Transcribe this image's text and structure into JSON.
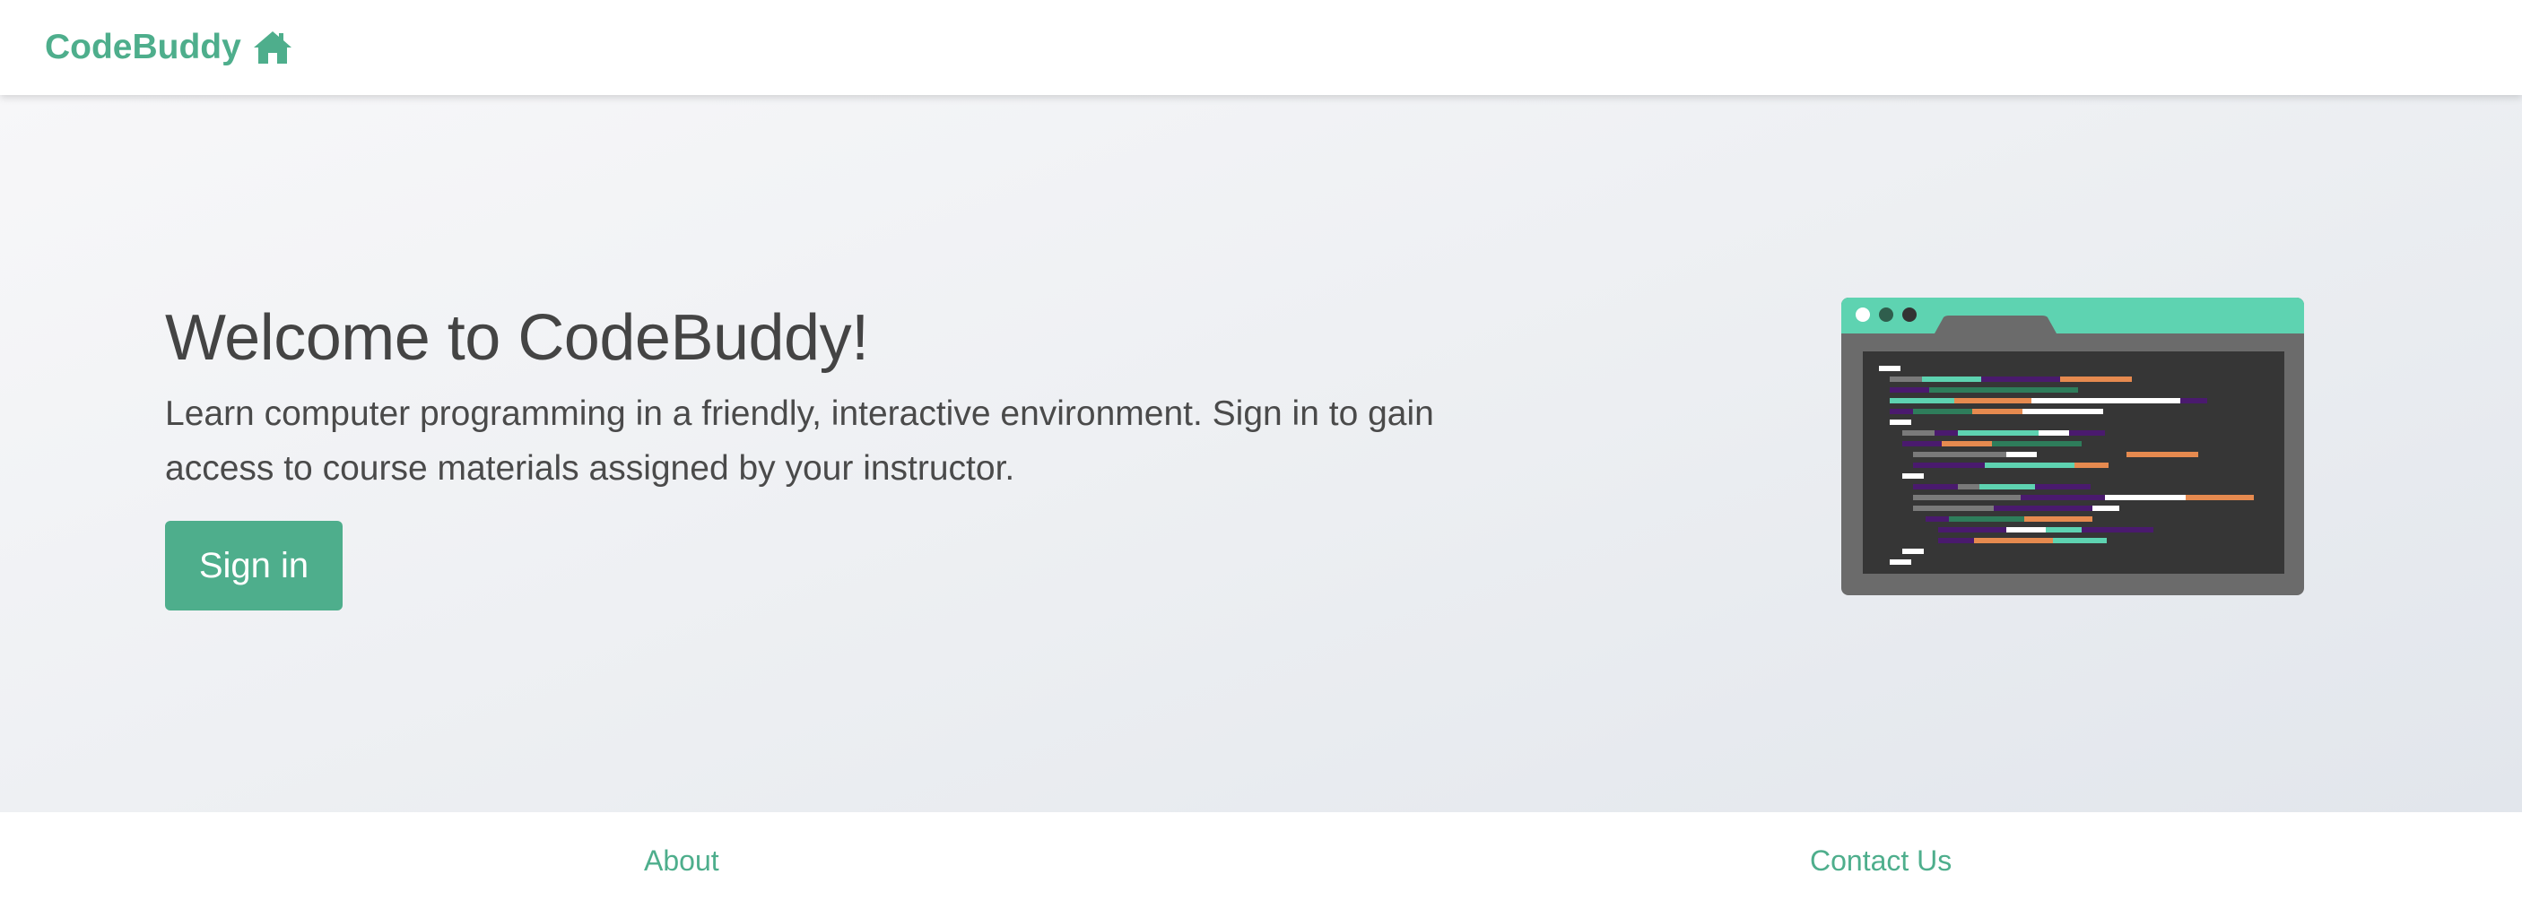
{
  "navbar": {
    "brand_label": "CodeBuddy",
    "brand_icon": "home-icon"
  },
  "hero": {
    "title": "Welcome to CodeBuddy!",
    "lead": "Learn computer programming in a friendly, interactive environment. Sign in to gain access to course materials assigned by your instructor.",
    "signin_label": "Sign in",
    "illustration_icon": "code-editor-window-icon"
  },
  "footer": {
    "about_label": "About",
    "contact_label": "Contact Us"
  },
  "colors": {
    "brand": "#4eae8c",
    "window_accent": "#5ed3b1",
    "window_frame": "#6b6b6b",
    "editor_bg": "#363636",
    "code_orange": "#e68a4f",
    "code_purple": "#4a1a6e",
    "code_green": "#2e7d5b",
    "code_teal": "#5ed3b1",
    "code_gray": "#7a7a7a",
    "code_white": "#ffffff"
  }
}
